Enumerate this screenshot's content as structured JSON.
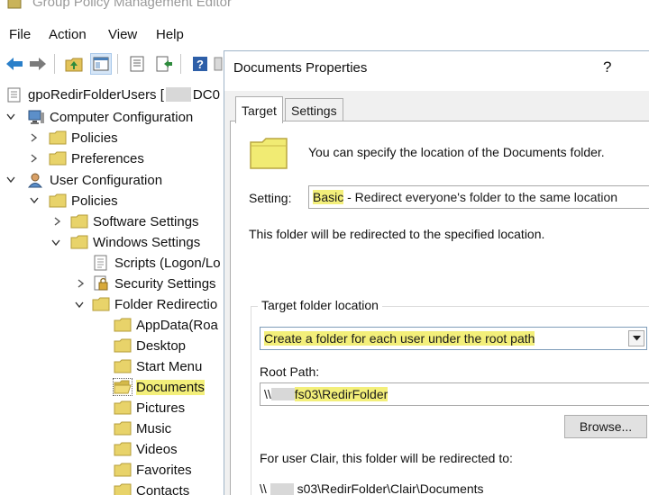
{
  "window": {
    "title": "Group Policy Management Editor"
  },
  "menu": [
    "File",
    "Action",
    "View",
    "Help"
  ],
  "toolbar": {
    "buttons": [
      "back-arrow-icon",
      "forward-arrow-icon",
      "up-folder-icon",
      "show-hide-tree-icon",
      "properties-icon",
      "export-list-icon",
      "help-icon",
      "filter-icon"
    ]
  },
  "tree": {
    "root": {
      "prefix": "gpoRedirFolderUsers [",
      "suffix": "DC0"
    },
    "computer_configuration": "Computer Configuration",
    "cc_policies": "Policies",
    "cc_preferences": "Preferences",
    "user_configuration": "User Configuration",
    "uc_policies": "Policies",
    "software_settings": "Software Settings",
    "windows_settings": "Windows Settings",
    "scripts": "Scripts (Logon/Lo",
    "security_settings": "Security Settings",
    "folder_redirection": "Folder Redirectio",
    "folders": [
      "AppData(Roa",
      "Desktop",
      "Start Menu",
      "Documents",
      "Pictures",
      "Music",
      "Videos",
      "Favorites",
      "Contacts"
    ],
    "selected": "Documents"
  },
  "dialog": {
    "title": "Documents Properties",
    "help": "?",
    "tabs": [
      "Target",
      "Settings"
    ],
    "active_tab": "Target",
    "description": "You can specify the location of the Documents folder.",
    "setting_label": "Setting:",
    "setting_value_highlight": "Basic",
    "setting_value_rest": " - Redirect everyone's folder to the same location",
    "info": "This folder will be redirected to the specified location.",
    "target_group_label": "Target folder location",
    "target_value": "Create a folder for each user under the root path",
    "root_path_label": "Root Path:",
    "root_path_prefix": "\\\\",
    "root_path_value": "fs03\\RedirFolder",
    "browse_button": "Browse...",
    "for_user_text": "For user Clair, this folder will be redirected to:",
    "result_prefix": "\\\\",
    "result_value": "s03\\RedirFolder\\Clair\\Documents"
  },
  "colors": {
    "highlight": "#f3ef7a",
    "folder": "#e8d36a",
    "selection": "#d6e6f7"
  }
}
